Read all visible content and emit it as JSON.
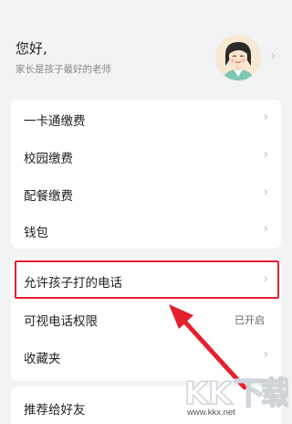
{
  "profile": {
    "greeting": "您好,",
    "subtitle": "家长是孩子最好的老师",
    "chevron": "›"
  },
  "menu_group1": [
    {
      "label": "一卡通缴费",
      "chevron": "›"
    },
    {
      "label": "校园缴费",
      "chevron": "›"
    },
    {
      "label": "配餐缴费",
      "chevron": "›"
    },
    {
      "label": "钱包",
      "chevron": "›"
    }
  ],
  "menu_group2": [
    {
      "label": "允许孩子打的电话",
      "chevron": "›"
    },
    {
      "label": "可视电话权限",
      "status": "已开启"
    },
    {
      "label": "收藏夹",
      "chevron": "›"
    }
  ],
  "menu_group3": [
    {
      "label": "推荐给好友"
    }
  ],
  "watermark": {
    "logo": "KK下载",
    "url": "www.kkx.net"
  },
  "colors": {
    "highlight": "#e5202e",
    "arrow": "#e5202e",
    "background": "#f2f3f5"
  }
}
